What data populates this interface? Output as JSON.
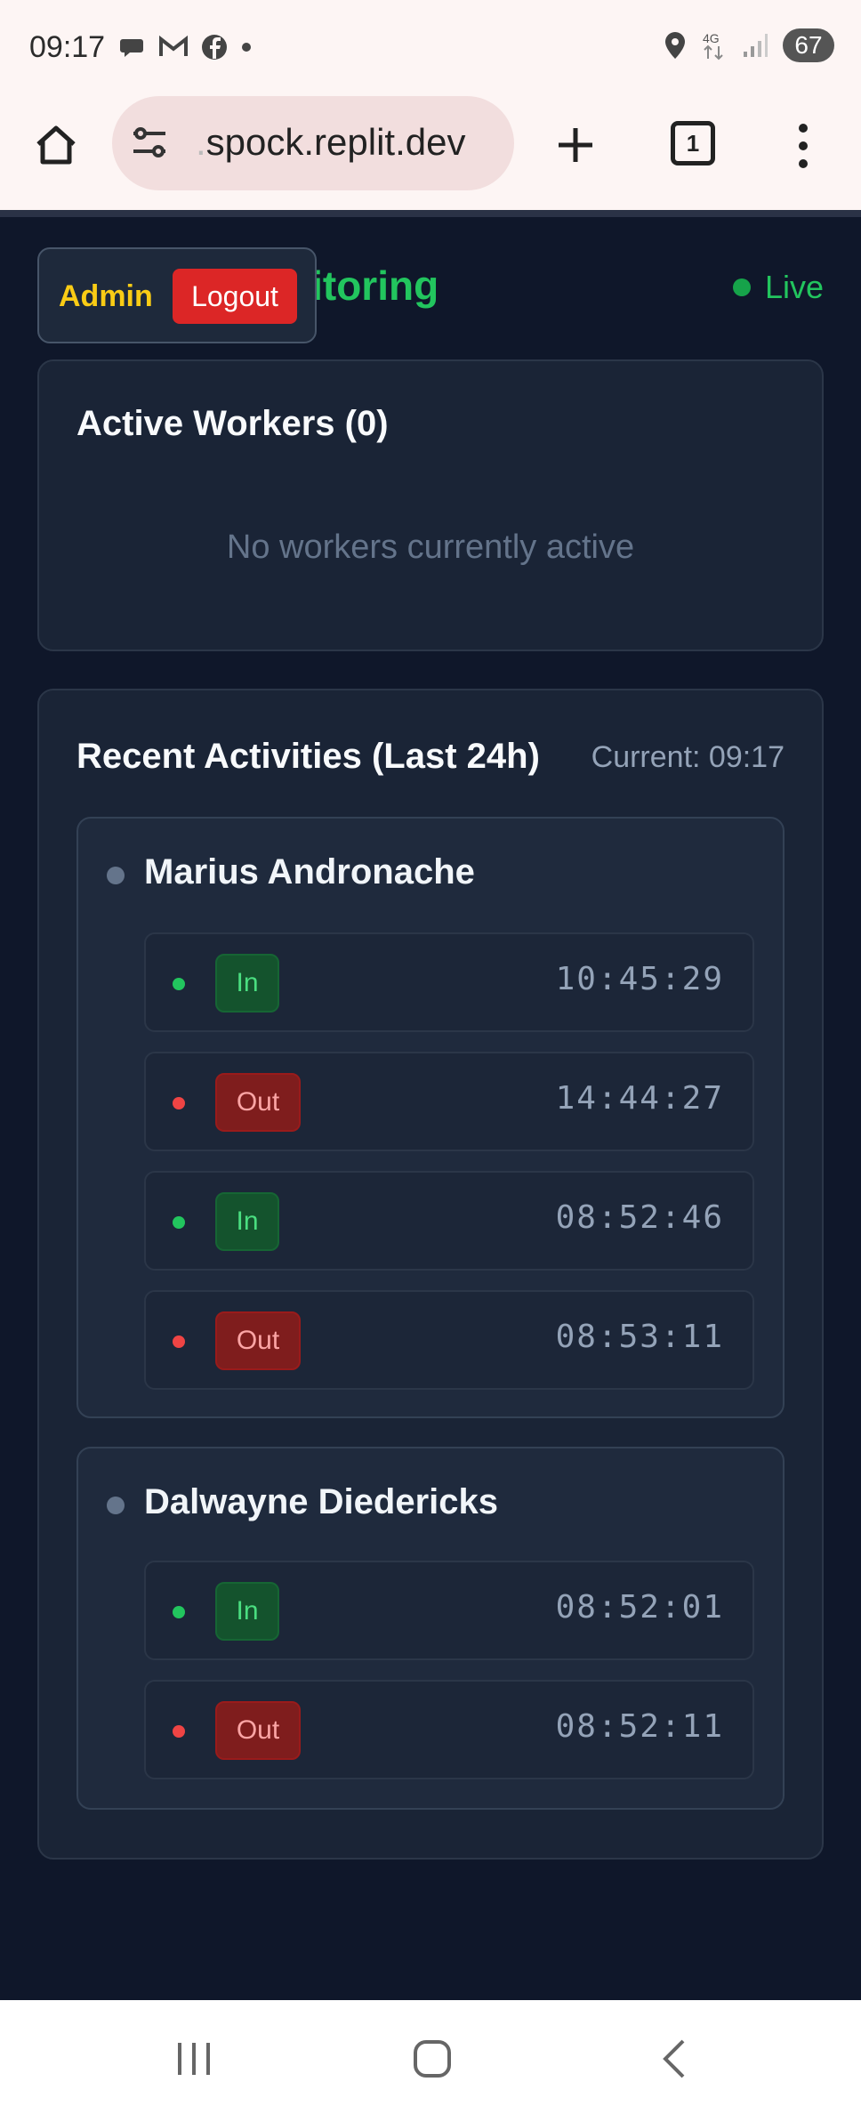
{
  "status_bar": {
    "time": "09:17",
    "battery": "67",
    "icons_left": [
      "chat-bubble-icon",
      "gmail-icon",
      "facebook-icon",
      "notification-dot-icon"
    ],
    "icons_right": [
      "location-pin-icon",
      "4g-icon",
      "signal-icon",
      "battery-icon"
    ]
  },
  "browser": {
    "url_prefix": ".",
    "url": "spock.replit.dev",
    "tab_count": "1"
  },
  "header": {
    "title_visible": "nitoring",
    "live_label": "Live",
    "admin_label": "Admin",
    "logout_label": "Logout"
  },
  "active_workers": {
    "title": "Active Workers (0)",
    "empty_message": "No workers currently active"
  },
  "recent": {
    "title": "Recent Activities (Last 24h)",
    "current": "Current: 09:17",
    "workers": [
      {
        "name": "Marius Andronache",
        "activities": [
          {
            "type": "In",
            "time": "10:45:29"
          },
          {
            "type": "Out",
            "time": "14:44:27"
          },
          {
            "type": "In",
            "time": "08:52:46"
          },
          {
            "type": "Out",
            "time": "08:53:11"
          }
        ]
      },
      {
        "name": "Dalwayne Diedericks",
        "activities": [
          {
            "type": "In",
            "time": "08:52:01"
          },
          {
            "type": "Out",
            "time": "08:52:11"
          }
        ]
      }
    ]
  },
  "colors": {
    "background": "#0f172a",
    "card": "#1a2436",
    "accent_green": "#22c55e",
    "danger_red": "#dc2626",
    "admin_yellow": "#facc15"
  }
}
